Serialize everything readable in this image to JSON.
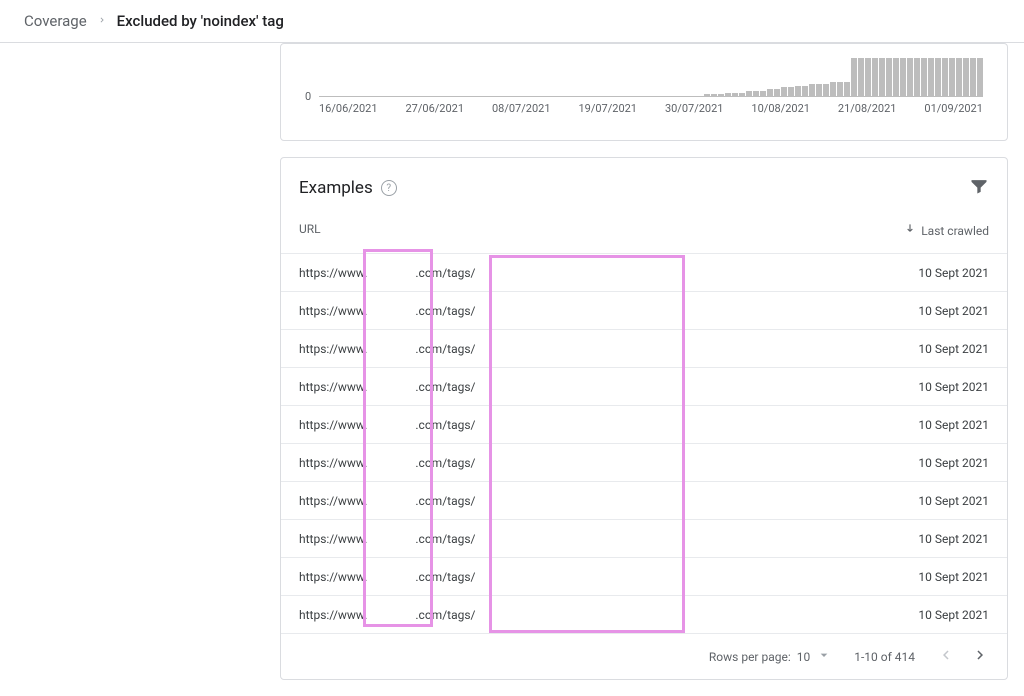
{
  "breadcrumb": {
    "parent": "Coverage",
    "current": "Excluded by 'noindex' tag"
  },
  "chart_data": {
    "type": "bar",
    "y_zero": "0",
    "x_ticks": [
      "16/06/2021",
      "27/06/2021",
      "08/07/2021",
      "19/07/2021",
      "30/07/2021",
      "10/08/2021",
      "21/08/2021",
      "01/09/2021"
    ],
    "values": [
      0,
      0,
      0,
      0,
      0,
      0,
      0,
      0,
      0,
      0,
      0,
      0,
      0,
      0,
      0,
      0,
      0,
      0,
      0,
      0,
      0,
      0,
      0,
      0,
      0,
      0,
      0,
      0,
      0,
      0,
      0,
      0,
      0,
      0,
      0,
      0,
      0,
      0,
      0,
      0,
      0,
      0,
      0,
      0,
      0,
      0,
      0,
      0,
      0,
      0,
      0,
      0,
      0,
      0,
      0,
      1,
      1,
      1,
      2,
      2,
      2,
      3,
      3,
      3,
      4,
      4,
      5,
      5,
      6,
      6,
      7,
      7,
      7,
      8,
      8,
      8,
      22,
      22,
      22,
      22,
      22,
      22,
      22,
      22,
      22,
      22,
      22,
      22,
      22,
      22,
      22,
      22,
      22,
      22,
      22
    ]
  },
  "examples": {
    "title": "Examples",
    "columns": {
      "url": "URL",
      "last_crawled": "Last crawled"
    },
    "filter_label": "Filter",
    "help_label": "Help",
    "rows": [
      {
        "prefix": "https://www.",
        "mid": ".com/tags/",
        "date": "10 Sept 2021"
      },
      {
        "prefix": "https://www.",
        "mid": ".com/tags/",
        "date": "10 Sept 2021"
      },
      {
        "prefix": "https://www.",
        "mid": ".com/tags/",
        "date": "10 Sept 2021"
      },
      {
        "prefix": "https://www.",
        "mid": ".com/tags/",
        "date": "10 Sept 2021"
      },
      {
        "prefix": "https://www.",
        "mid": ".com/tags/",
        "date": "10 Sept 2021"
      },
      {
        "prefix": "https://www.",
        "mid": ".com/tags/",
        "date": "10 Sept 2021"
      },
      {
        "prefix": "https://www.",
        "mid": ".com/tags/",
        "date": "10 Sept 2021"
      },
      {
        "prefix": "https://www.",
        "mid": ".com/tags/",
        "date": "10 Sept 2021"
      },
      {
        "prefix": "https://www.",
        "mid": ".com/tags/",
        "date": "10 Sept 2021"
      },
      {
        "prefix": "https://www.",
        "mid": ".com/tags/",
        "date": "10 Sept 2021"
      }
    ]
  },
  "pagination": {
    "rows_per_page_label": "Rows per page:",
    "rows_per_page_value": "10",
    "range": "1-10 of 414"
  }
}
